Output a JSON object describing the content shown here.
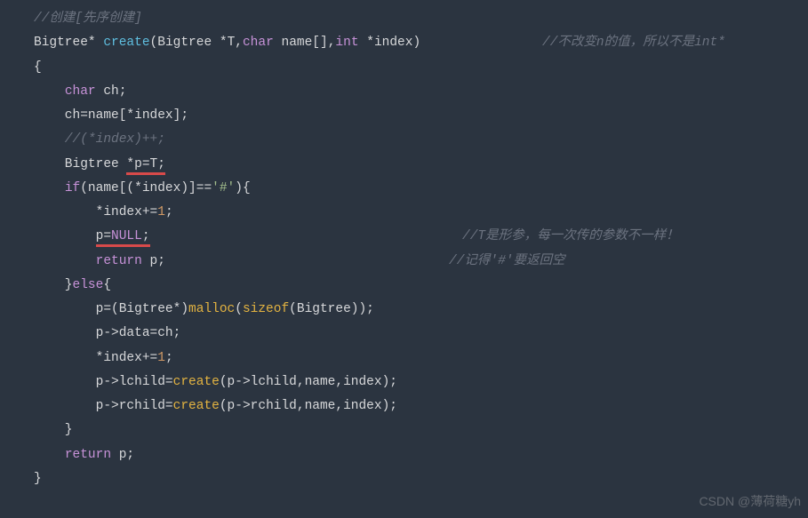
{
  "lines": {
    "l1_comment": "//创建[先序创建]",
    "l2_type1": "Bigtree",
    "l2_star1": "*",
    "l2_func": "create",
    "l2_open": "(",
    "l2_type2": "Bigtree ",
    "l2_star2": "*",
    "l2_param1": "T",
    "l2_comma1": ",",
    "l2_kw_char": "char",
    "l2_param2": " name[]",
    "l2_comma2": ",",
    "l2_kw_int": "int",
    "l2_star3": " *",
    "l2_param3": "index",
    "l2_close": ")",
    "l2_right_comment": "//不改变n的值，所以不是int*",
    "l3": "{",
    "l4_kw": "char",
    "l4_rest": " ch;",
    "l5": "    ch=name[*index];",
    "l6_comment": "    //(*index)++;",
    "l7_a": "    Bigtree ",
    "l7_b": "*p=T;",
    "l8_kw_if": "if",
    "l8_a": "(name[(*index)]==",
    "l8_str": "'#'",
    "l8_b": "){",
    "l9_a": "        *index+=",
    "l9_num": "1",
    "l9_b": ";",
    "l10_a": "        ",
    "l10_b": "p=",
    "l10_null": "NULL",
    "l10_c": ";",
    "l10_right_comment": "//T是形参，每一次传的参数不一样！",
    "l11_kw": "return",
    "l11_rest": " p;",
    "l11_right_comment": "//记得'#'要返回空",
    "l12_a": "    }",
    "l12_kw": "else",
    "l12_b": "{",
    "l13_a": "        p=(Bigtree*)",
    "l13_malloc": "malloc",
    "l13_b": "(",
    "l13_sizeof": "sizeof",
    "l13_c": "(Bigtree));",
    "l14": "        p->data=ch;",
    "l15_a": "        *index+=",
    "l15_num": "1",
    "l15_b": ";",
    "l16_a": "        p->lchild=",
    "l16_func": "create",
    "l16_b": "(p->lchild,name,index);",
    "l17_a": "        p->rchild=",
    "l17_func": "create",
    "l17_b": "(p->rchild,name,index);",
    "l18": "    }",
    "l19_kw": "return",
    "l19_rest": " p;",
    "l20": "}"
  },
  "watermark": "CSDN @薄荷糖yh"
}
